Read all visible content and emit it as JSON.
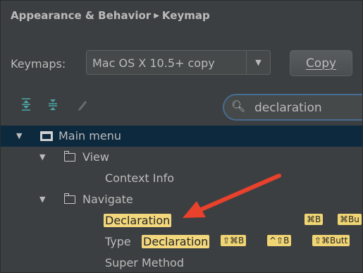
{
  "breadcrumb": {
    "parent": "Appearance & Behavior",
    "current": "Keymap"
  },
  "keymaps": {
    "label": "Keymaps:",
    "selected": "Mac OS X 10.5+ copy",
    "copy_button": "Copy"
  },
  "toolbar": {
    "icons": [
      "expand-all-icon",
      "collapse-all-icon",
      "edit-icon"
    ]
  },
  "search": {
    "value": "declaration"
  },
  "tree": {
    "main_menu": "Main menu",
    "view": "View",
    "context_info": "Context Info",
    "navigate": "Navigate",
    "declaration": "Declaration",
    "declaration_shortcuts": [
      "⌘B",
      "⌘Bu"
    ],
    "type_prefix": "Type",
    "type_match": "Declaration",
    "type_shortcuts": [
      "⇧⌘B",
      "^⇧B",
      "⇧⌘Butt"
    ],
    "super_method": "Super Method"
  },
  "colors": {
    "background": "#3c3f41",
    "selection": "#0d293e",
    "match_highlight": "#f2d77c",
    "annotation_arrow": "#e8412c",
    "search_focus": "#466d94"
  }
}
